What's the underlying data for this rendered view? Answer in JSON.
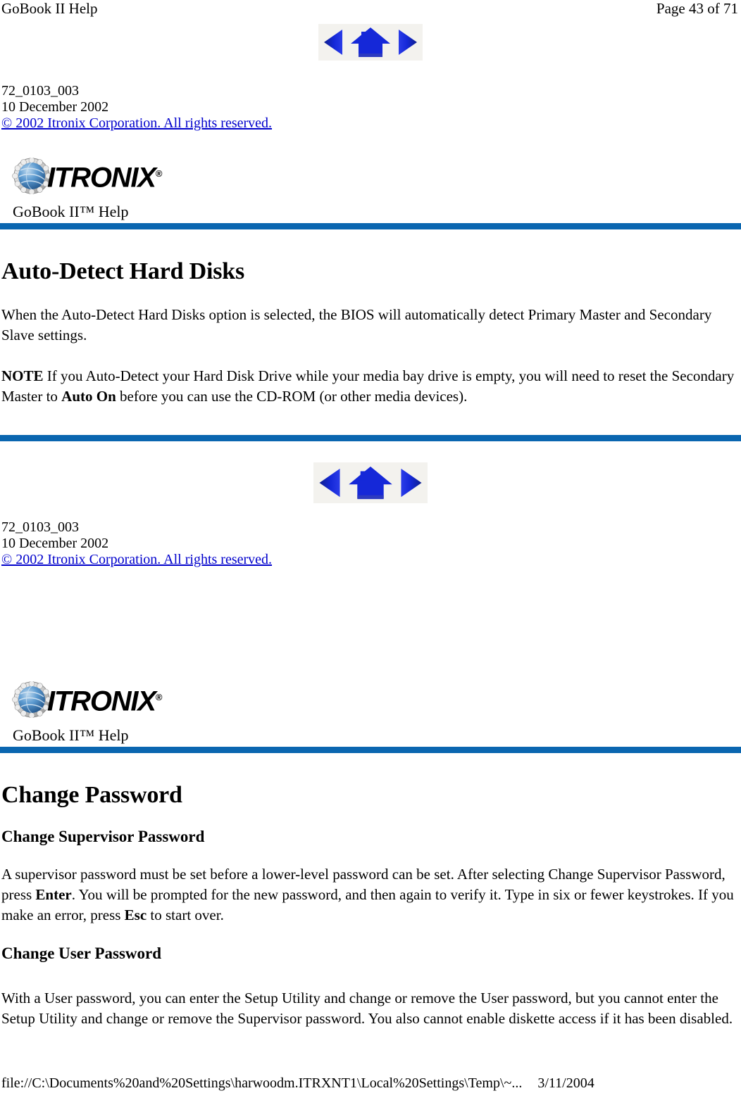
{
  "print_header": {
    "document_title": "GoBook II Help",
    "page_label": "Page 43 of 71"
  },
  "print_footer": {
    "url": "file://C:\\Documents%20and%20Settings\\harwoodm.ITRXNT1\\Local%20Settings\\Temp\\~...",
    "date": "3/11/2004"
  },
  "nav": {
    "back_label": "back-arrow",
    "home_label": "home-house",
    "forward_label": "forward-arrow"
  },
  "meta": {
    "doc_number": "72_0103_003",
    "doc_date": "10 December 2002",
    "copyright": "© 2002 Itronix Corporation.  All rights reserved."
  },
  "brand": {
    "wordmark": "ITRONIX",
    "registered": "®",
    "product_title": "GoBook II™ Help"
  },
  "topic_one": {
    "title": "Auto-Detect Hard Disks",
    "paragraph_1": "When the Auto-Detect Hard Disks option is selected, the BIOS will automatically detect Primary Master and Secondary Slave settings.",
    "note_label": "NOTE",
    "note_part_1": "  If you Auto-Detect your Hard Disk Drive while your media bay drive is empty, you will need to reset the Secondary Master to ",
    "note_bold": "Auto On",
    "note_part_2": " before you can use the CD-ROM (or other media devices)."
  },
  "topic_two": {
    "title": "Change Password",
    "sub_title_1": "Change Supervisor Password",
    "paragraph_1_part_1": "A supervisor password must be set before a lower-level password can be set.  After selecting Change Supervisor Password, press ",
    "paragraph_1_bold_1": "Enter",
    "paragraph_1_part_2": ".  You will be prompted for the new password, and then again to verify it.  Type in six or fewer keystrokes.  If you make an error, press ",
    "paragraph_1_bold_2": "Esc",
    "paragraph_1_part_3": " to start over.",
    "sub_title_2": "Change User Password",
    "paragraph_2": "With a User password, you can enter the Setup Utility and change or remove the User password, but you cannot enter the Setup Utility and change or remove the Supervisor password.  You also cannot enable diskette access if it has been disabled."
  },
  "colors": {
    "rule_blue": "#0A66B0",
    "link_blue": "#0000CC",
    "icon_blue": "#1528D8",
    "globe_blue": "#2E72B8"
  }
}
